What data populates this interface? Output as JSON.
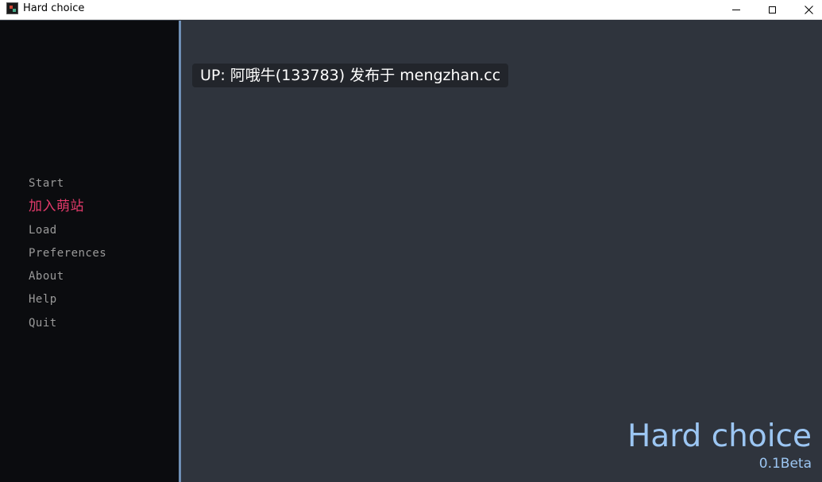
{
  "window": {
    "title": "Hard choice",
    "controls": {
      "minimize_icon": "minimize-icon",
      "maximize_icon": "maximize-icon",
      "close_icon": "close-icon"
    }
  },
  "sidebar": {
    "menu": [
      {
        "label": "Start",
        "selected": false
      },
      {
        "label": "加入萌站",
        "selected": true
      },
      {
        "label": "Load",
        "selected": false
      },
      {
        "label": "Preferences",
        "selected": false
      },
      {
        "label": "About",
        "selected": false
      },
      {
        "label": "Help",
        "selected": false
      },
      {
        "label": "Quit",
        "selected": false
      }
    ]
  },
  "main": {
    "notice": "UP: 阿哦牛(133783) 发布于 mengzhan.cc",
    "game_title": "Hard choice",
    "version": "0.1Beta"
  },
  "colors": {
    "sidebar_bg": "#0b0c0f",
    "main_bg": "#2f343d",
    "divider": "#6f8fb5",
    "menu_text": "#9a9a9a",
    "menu_selected": "#e23a6a",
    "title_accent": "#9cc6f3"
  }
}
